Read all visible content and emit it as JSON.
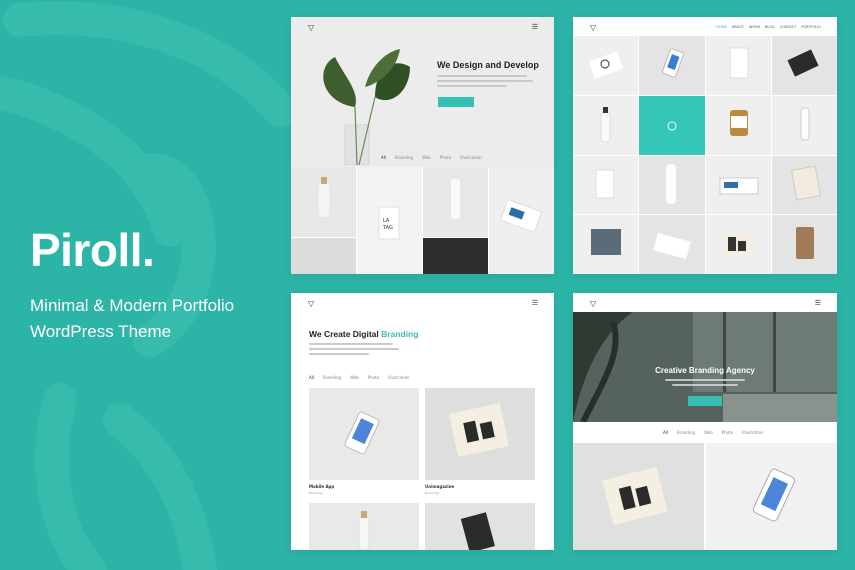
{
  "brand": {
    "name": "Piroll.",
    "tagline_line1": "Minimal & Modern Portfolio",
    "tagline_line2": "WordPress Theme"
  },
  "colors": {
    "background": "#2cb4a6",
    "accent": "#36c0b2"
  },
  "icons": {
    "logo": "triangle-logo-icon",
    "menu": "hamburger-menu-icon"
  },
  "preview1": {
    "hero_title": "We Design and Develop",
    "filters": [
      "All",
      "Branding",
      "Web",
      "Photo",
      "Illustration"
    ]
  },
  "preview2": {
    "nav": [
      "HOME",
      "ABOUT",
      "WORK",
      "BLOG",
      "CONTACT",
      "PORTFOLIO"
    ]
  },
  "preview3": {
    "hero_title_prefix": "We Create Digital",
    "hero_title_accent": "Branding",
    "filters": [
      "All",
      "Branding",
      "Web",
      "Photo",
      "Illustration"
    ],
    "cards": [
      {
        "title": "Mobile App",
        "subtitle": "Branding"
      },
      {
        "title": "Unimagazine",
        "subtitle": "Branding"
      }
    ]
  },
  "preview4": {
    "hero_title": "Creative Branding Agency",
    "filters": [
      "All",
      "Branding",
      "Web",
      "Photo",
      "Illustration"
    ]
  }
}
